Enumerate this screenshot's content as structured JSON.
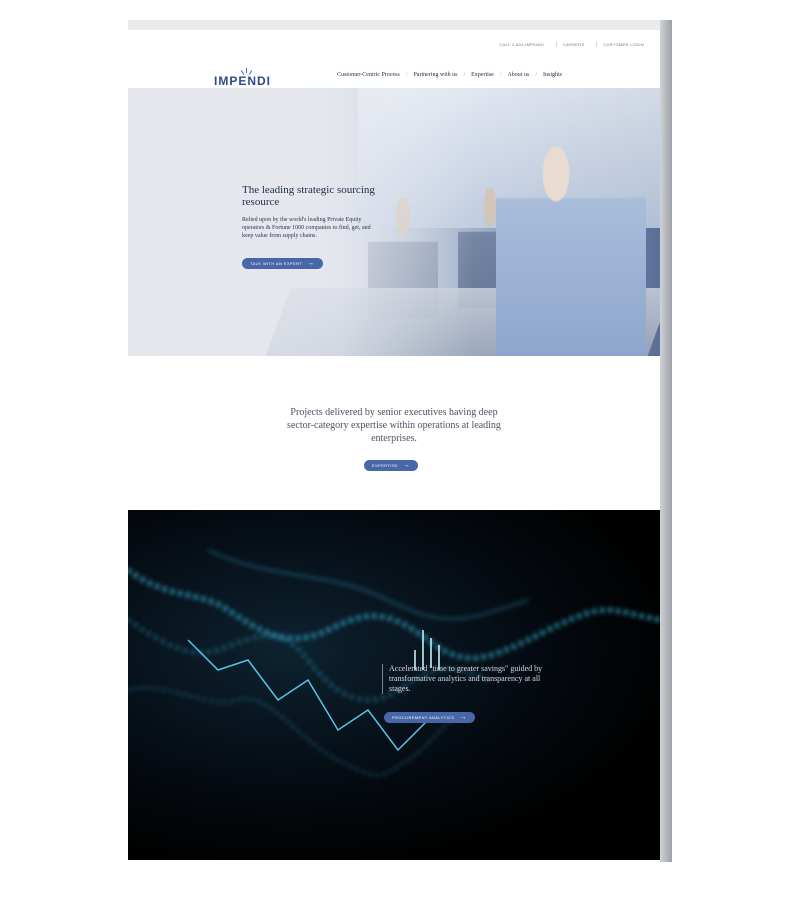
{
  "utility_links": [
    "CALL 1-844-IMPENDI",
    "CAREERS",
    "CUSTOMER LOGIN"
  ],
  "brand": {
    "name": "IMPENDI"
  },
  "nav": {
    "items": [
      "Customer-Centric Process",
      "Partnering with us",
      "Expertise",
      "About us",
      "Insights"
    ],
    "separator": "/"
  },
  "hero": {
    "title": "The leading strategic sourcing resource",
    "body": "Relied upon by the world's leading Private Equity operators & Fortune 1000 companies to find, get, and keep value from supply chains.",
    "cta": "TALK WITH AN EXPERT"
  },
  "middle": {
    "text": "Projects delivered by senior executives having deep sector-category expertise within operations at leading enterprises.",
    "cta": "EXPERTISE"
  },
  "analytics": {
    "text": "Accelerated \"time to greater savings\" guided by transformative analytics and transparency at all stages.",
    "cta": "PROCUREMENT ANALYTICS"
  },
  "colors": {
    "brand_blue": "#2e4a8a",
    "button": "#4767a8",
    "dark_bg": "#000000",
    "chart_glow": "#3fd4ff"
  },
  "icons": {
    "arrow": "arrow-right-icon",
    "logo_mark": "logo-rays-icon"
  }
}
